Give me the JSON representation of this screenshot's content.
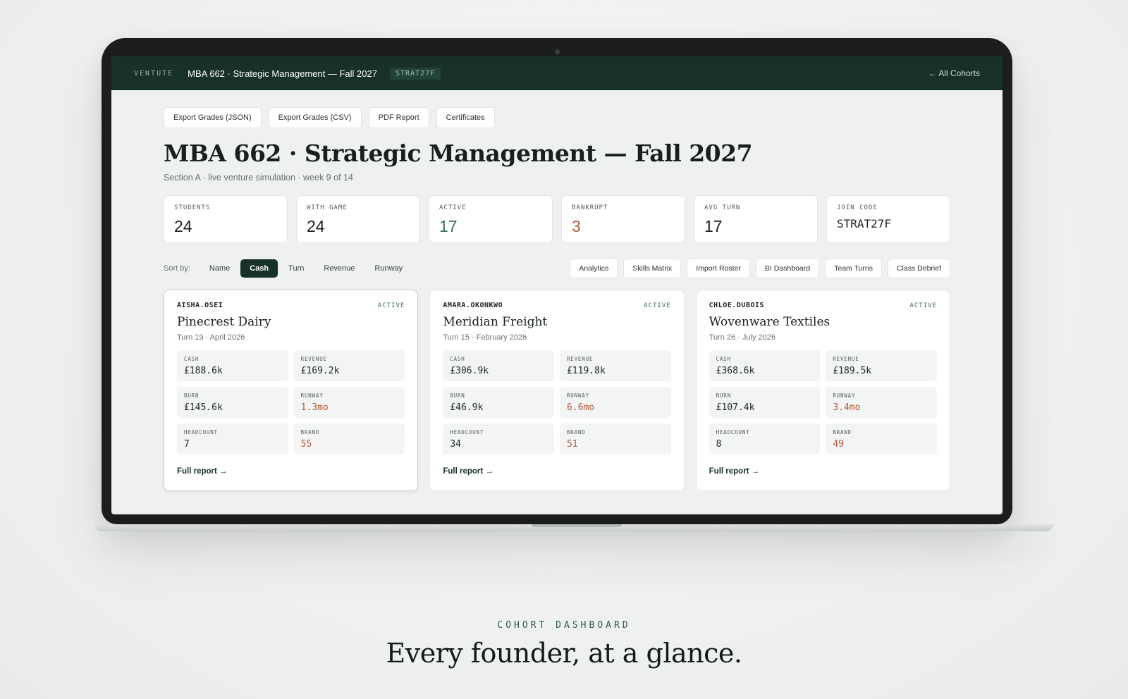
{
  "app": {
    "brand": "VENTUTE",
    "course_title": "MBA 662 · Strategic Management — Fall 2027",
    "code_badge": "STRAT27F",
    "back_link": "← All Cohorts"
  },
  "exports": [
    "Export Grades (JSON)",
    "Export Grades (CSV)",
    "PDF Report",
    "Certificates"
  ],
  "page": {
    "title": "MBA 662 · Strategic Management — Fall 2027",
    "subtitle": "Section A · live venture simulation · week 9 of 14"
  },
  "stats": [
    {
      "label": "STUDENTS",
      "value": "24",
      "color": "#1b211e"
    },
    {
      "label": "WITH GAME",
      "value": "24",
      "color": "#1b211e"
    },
    {
      "label": "ACTIVE",
      "value": "17",
      "color": "#3d6b5c"
    },
    {
      "label": "BANKRUPT",
      "value": "3",
      "color": "#b55a3a"
    },
    {
      "label": "AVG TURN",
      "value": "17",
      "color": "#1b211e"
    },
    {
      "label": "JOIN CODE",
      "value": "STRAT27F",
      "color": "#1b211e"
    }
  ],
  "sort": {
    "label": "Sort by:",
    "options": [
      "Name",
      "Cash",
      "Turn",
      "Revenue",
      "Runway"
    ],
    "active": "Cash"
  },
  "tools": [
    "Analytics",
    "Skills Matrix",
    "Import Roster",
    "BI Dashboard",
    "Team Turns",
    "Class Debrief"
  ],
  "cards": [
    {
      "user": "AISHA.OSEI",
      "status": "ACTIVE",
      "company": "Pinecrest Dairy",
      "turn": "Turn 19 · April 2026",
      "metrics": {
        "cash": {
          "label": "CASH",
          "value": "£188.6k"
        },
        "revenue": {
          "label": "REVENUE",
          "value": "£169.2k"
        },
        "burn": {
          "label": "BURN",
          "value": "£145.6k"
        },
        "runway": {
          "label": "RUNWAY",
          "value": "1.3mo"
        },
        "headcount": {
          "label": "HEADCOUNT",
          "value": "7"
        },
        "brand": {
          "label": "BRAND",
          "value": "55"
        }
      },
      "link": "Full report →"
    },
    {
      "user": "AMARA.OKONKWO",
      "status": "ACTIVE",
      "company": "Meridian Freight",
      "turn": "Turn 15 · February 2026",
      "metrics": {
        "cash": {
          "label": "CASH",
          "value": "£306.9k"
        },
        "revenue": {
          "label": "REVENUE",
          "value": "£119.8k"
        },
        "burn": {
          "label": "BURN",
          "value": "£46.9k"
        },
        "runway": {
          "label": "RUNWAY",
          "value": "6.6mo"
        },
        "headcount": {
          "label": "HEADCOUNT",
          "value": "34"
        },
        "brand": {
          "label": "BRAND",
          "value": "51"
        }
      },
      "link": "Full report →"
    },
    {
      "user": "CHLOE.DUBOIS",
      "status": "ACTIVE",
      "company": "Wovenware Textiles",
      "turn": "Turn 26 · July 2026",
      "metrics": {
        "cash": {
          "label": "CASH",
          "value": "£368.6k"
        },
        "revenue": {
          "label": "REVENUE",
          "value": "£189.5k"
        },
        "burn": {
          "label": "BURN",
          "value": "£107.4k"
        },
        "runway": {
          "label": "RUNWAY",
          "value": "3.4mo"
        },
        "headcount": {
          "label": "HEADCOUNT",
          "value": "8"
        },
        "brand": {
          "label": "BRAND",
          "value": "49"
        }
      },
      "link": "Full report →"
    }
  ],
  "caption": {
    "eyebrow": "COHORT DASHBOARD",
    "tagline": "Every founder, at a glance."
  }
}
